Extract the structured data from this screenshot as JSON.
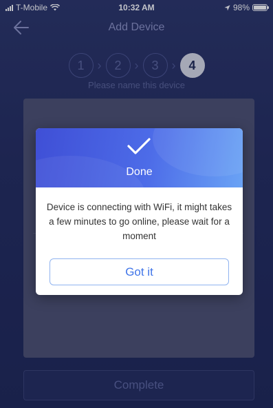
{
  "status_bar": {
    "carrier": "T-Mobile",
    "time": "10:32 AM",
    "battery": "98%",
    "battery_level": 0.98
  },
  "header": {
    "title": "Add Device",
    "back_icon": "arrow-left-icon"
  },
  "stepper": {
    "steps": [
      "1",
      "2",
      "3",
      "4"
    ],
    "active_step": 4,
    "hint": "Please name this device"
  },
  "footer": {
    "complete_label": "Complete"
  },
  "modal": {
    "icon": "checkmark-icon",
    "title": "Done",
    "message": "Device is connecting with WiFi,  it might takes a few minutes to go online, please wait for a moment",
    "button_label": "Got it"
  },
  "colors": {
    "background": "#232c5e",
    "modal_gradient_start": "#3f4fd6",
    "modal_gradient_end": "#6aa3f5",
    "accent": "#3f74e8"
  }
}
